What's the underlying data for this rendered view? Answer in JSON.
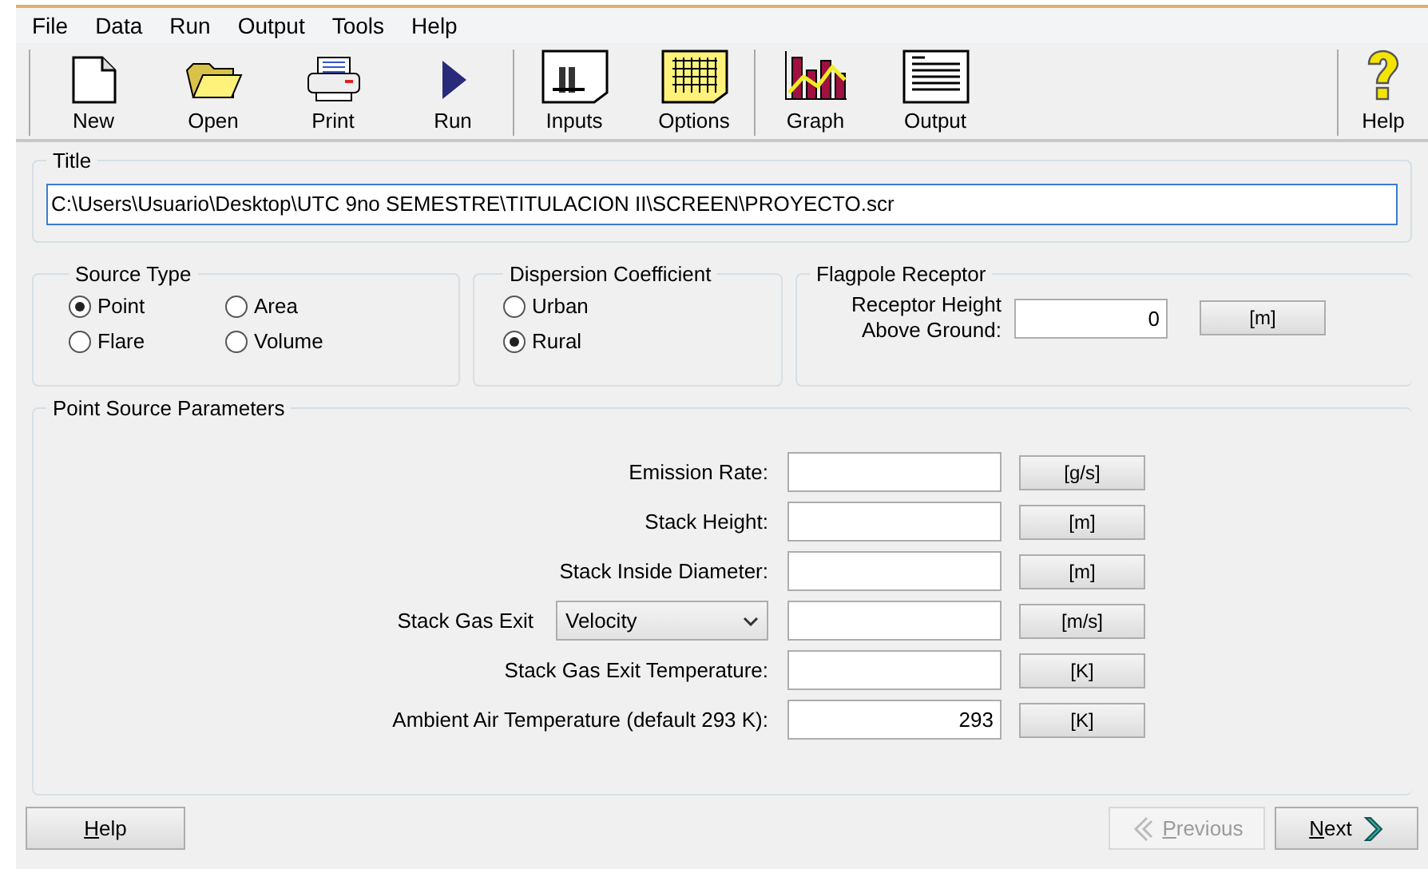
{
  "menu": [
    "File",
    "Data",
    "Run",
    "Output",
    "Tools",
    "Help"
  ],
  "toolbar": [
    [
      {
        "label": "New"
      },
      {
        "label": "Open"
      },
      {
        "label": "Print"
      },
      {
        "label": "Run"
      }
    ],
    [
      {
        "label": "Inputs"
      },
      {
        "label": "Options"
      }
    ],
    [
      {
        "label": "Graph"
      },
      {
        "label": "Output"
      }
    ]
  ],
  "toolbar_help": {
    "label": "Help"
  },
  "title_group": {
    "legend": "Title",
    "value": "C:\\Users\\Usuario\\Desktop\\UTC 9no SEMESTRE\\TITULACION II\\SCREEN\\PROYECTO.scr"
  },
  "source_type": {
    "legend": "Source Type",
    "options": [
      {
        "label": "Point",
        "selected": true
      },
      {
        "label": "Area",
        "selected": false
      },
      {
        "label": "Flare",
        "selected": false
      },
      {
        "label": "Volume",
        "selected": false
      }
    ]
  },
  "dispersion": {
    "legend": "Dispersion Coefficient",
    "options": [
      {
        "label": "Urban",
        "selected": false
      },
      {
        "label": "Rural",
        "selected": true
      }
    ]
  },
  "flagpole": {
    "legend": "Flagpole Receptor",
    "label_lines": [
      "Receptor Height",
      "Above Ground:"
    ],
    "value": "0",
    "unit": "[m]"
  },
  "point_source": {
    "legend": "Point Source Parameters",
    "rows": [
      {
        "kind": "label",
        "label": "Emission Rate:",
        "unit": "[g/s]"
      },
      {
        "kind": "label",
        "label": "Stack Height:",
        "unit": "[m]"
      },
      {
        "kind": "label",
        "label": "Stack Inside Diameter:",
        "unit": "[m]"
      },
      {
        "kind": "select",
        "label": "Stack Gas Exit",
        "select": "Velocity",
        "unit": "[m/s]"
      },
      {
        "kind": "label",
        "label": "Stack Gas Exit Temperature:",
        "unit": "[K]"
      },
      {
        "kind": "label",
        "label": "Ambient Air Temperature (default 293 K):",
        "value": "293",
        "unit": "[K]"
      }
    ]
  },
  "footer": {
    "help": {
      "label": "Help",
      "underline_first": true
    },
    "previous": {
      "label": "Previous",
      "underline_first": true,
      "disabled": true
    },
    "next": {
      "label": "Next",
      "underline_first": true,
      "disabled": false
    }
  }
}
